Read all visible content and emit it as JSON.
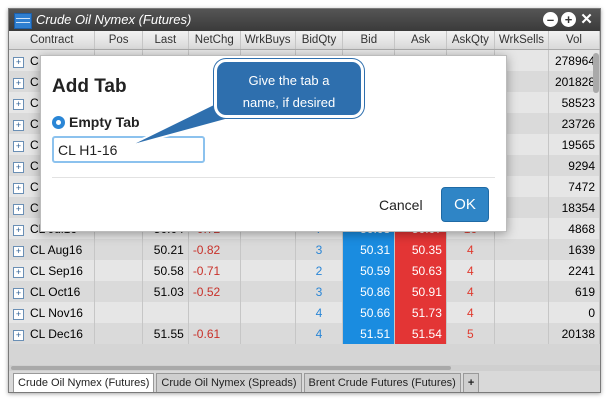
{
  "window": {
    "title": "Crude Oil Nymex (Futures)"
  },
  "columns": [
    "Contract",
    "Pos",
    "Last",
    "NetChg",
    "WrkBuys",
    "BidQty",
    "Bid",
    "Ask",
    "AskQty",
    "WrkSells",
    "Vol"
  ],
  "rows": [
    {
      "contract": "C",
      "pos": "",
      "last": "",
      "netchg": "",
      "wrkbuys": "",
      "bidqty": "",
      "bid": "",
      "ask": "",
      "askqty": "",
      "wrksells": "",
      "vol": "278964"
    },
    {
      "contract": "C",
      "pos": "",
      "last": "",
      "netchg": "",
      "wrkbuys": "",
      "bidqty": "",
      "bid": "",
      "ask": "",
      "askqty": "",
      "wrksells": "",
      "vol": "201828"
    },
    {
      "contract": "C",
      "pos": "",
      "last": "",
      "netchg": "",
      "wrkbuys": "",
      "bidqty": "",
      "bid": "",
      "ask": "",
      "askqty": "",
      "wrksells": "",
      "vol": "58523"
    },
    {
      "contract": "C",
      "pos": "",
      "last": "",
      "netchg": "",
      "wrkbuys": "",
      "bidqty": "",
      "bid": "",
      "ask": "",
      "askqty": "",
      "wrksells": "",
      "vol": "23726"
    },
    {
      "contract": "C",
      "pos": "",
      "last": "",
      "netchg": "",
      "wrkbuys": "",
      "bidqty": "",
      "bid": "",
      "ask": "",
      "askqty": "",
      "wrksells": "",
      "vol": "19565"
    },
    {
      "contract": "C",
      "pos": "",
      "last": "",
      "netchg": "",
      "wrkbuys": "",
      "bidqty": "",
      "bid": "",
      "ask": "",
      "askqty": "",
      "wrksells": "",
      "vol": "9294"
    },
    {
      "contract": "C",
      "pos": "",
      "last": "",
      "netchg": "",
      "wrkbuys": "",
      "bidqty": "",
      "bid": "",
      "ask": "",
      "askqty": "",
      "wrksells": "",
      "vol": "7472"
    },
    {
      "contract": "C",
      "pos": "",
      "last": "",
      "netchg": "",
      "wrkbuys": "",
      "bidqty": "",
      "bid": "",
      "ask": "",
      "askqty": "",
      "wrksells": "",
      "vol": "18354"
    },
    {
      "contract": "CL Jul16",
      "pos": "",
      "last": "50.04",
      "netchg": "-0.72",
      "wrkbuys": "",
      "bidqty": "7",
      "bid": "50.03",
      "ask": "50.07",
      "askqty": "16",
      "wrksells": "",
      "vol": "4868"
    },
    {
      "contract": "CL Aug16",
      "pos": "",
      "last": "50.21",
      "netchg": "-0.82",
      "wrkbuys": "",
      "bidqty": "3",
      "bid": "50.31",
      "ask": "50.35",
      "askqty": "4",
      "wrksells": "",
      "vol": "1639"
    },
    {
      "contract": "CL Sep16",
      "pos": "",
      "last": "50.58",
      "netchg": "-0.71",
      "wrkbuys": "",
      "bidqty": "2",
      "bid": "50.59",
      "ask": "50.63",
      "askqty": "4",
      "wrksells": "",
      "vol": "2241"
    },
    {
      "contract": "CL Oct16",
      "pos": "",
      "last": "51.03",
      "netchg": "-0.52",
      "wrkbuys": "",
      "bidqty": "3",
      "bid": "50.86",
      "ask": "50.91",
      "askqty": "4",
      "wrksells": "",
      "vol": "619"
    },
    {
      "contract": "CL Nov16",
      "pos": "",
      "last": "",
      "netchg": "",
      "wrkbuys": "",
      "bidqty": "4",
      "bid": "50.66",
      "ask": "51.73",
      "askqty": "4",
      "wrksells": "",
      "vol": "0"
    },
    {
      "contract": "CL Dec16",
      "pos": "",
      "last": "51.55",
      "netchg": "-0.61",
      "wrkbuys": "",
      "bidqty": "4",
      "bid": "51.51",
      "ask": "51.54",
      "askqty": "5",
      "wrksells": "",
      "vol": "20138"
    }
  ],
  "tabs": [
    "Crude Oil Nymex (Futures)",
    "Crude Oil Nymex (Spreads)",
    "Brent Crude Futures (Futures)"
  ],
  "add_tab_symbol": "+",
  "dialog": {
    "title": "Add Tab",
    "radio_label": "Empty Tab",
    "input_value": "CL H1-16",
    "cancel_label": "Cancel",
    "ok_label": "OK"
  },
  "callout": {
    "line1": "Give the tab a",
    "line2": "name, if desired"
  },
  "colors": {
    "bid": "#1a8ce0",
    "ask": "#e33535",
    "callout": "#2e6fae",
    "ok": "#2f85c6"
  }
}
